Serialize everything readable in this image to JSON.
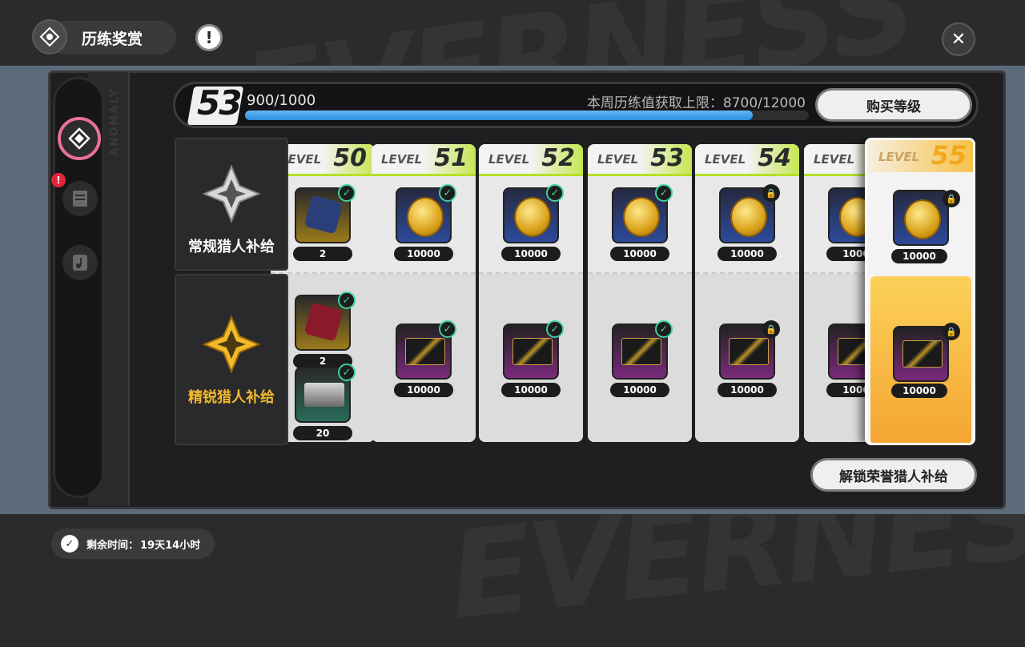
{
  "header": {
    "title": "历练奖赏",
    "info_icon": "exclamation-icon",
    "close_icon": "close-icon"
  },
  "background_text": [
    "EVERNESS",
    "EVERNESS"
  ],
  "sidebar": {
    "items": [
      {
        "icon": "pass-emblem-icon",
        "active": true
      },
      {
        "icon": "task-list-icon",
        "alert": "!"
      },
      {
        "icon": "music-note-icon"
      }
    ]
  },
  "progress": {
    "level": "53",
    "xp_text": "900/1000",
    "xp_fraction": 0.9,
    "weekly_limit": "本周历练值获取上限：8700/12000",
    "buy_level_button": "购买等级"
  },
  "tiers": {
    "normal": {
      "label": "常规猎人补给",
      "icon": "silver-star-emblem-icon"
    },
    "elite": {
      "label": "精锐猎人补给",
      "icon": "gold-star-emblem-icon"
    }
  },
  "level_word": "LEVEL",
  "levels": [
    {
      "level": "50",
      "normal": {
        "item": "dice-blue",
        "qty": "2",
        "status": "claimed"
      },
      "elite": [
        {
          "item": "dice-red",
          "qty": "2",
          "status": "claimed"
        },
        {
          "item": "box",
          "qty": "20",
          "status": "claimed"
        }
      ]
    },
    {
      "level": "51",
      "normal": {
        "item": "coin",
        "qty": "10000",
        "status": "claimed"
      },
      "elite": [
        {
          "item": "card",
          "qty": "10000",
          "status": "claimed"
        }
      ]
    },
    {
      "level": "52",
      "normal": {
        "item": "coin",
        "qty": "10000",
        "status": "claimed"
      },
      "elite": [
        {
          "item": "card",
          "qty": "10000",
          "status": "claimed"
        }
      ]
    },
    {
      "level": "53",
      "normal": {
        "item": "coin",
        "qty": "10000",
        "status": "claimed"
      },
      "elite": [
        {
          "item": "card",
          "qty": "10000",
          "status": "claimed"
        }
      ]
    },
    {
      "level": "54",
      "normal": {
        "item": "coin",
        "qty": "10000",
        "status": "locked"
      },
      "elite": [
        {
          "item": "card",
          "qty": "10000",
          "status": "locked"
        }
      ]
    },
    {
      "level": "",
      "normal": {
        "item": "coin",
        "qty": "1000",
        "status": "none"
      },
      "elite": [
        {
          "item": "card",
          "qty": "1000",
          "status": "none"
        }
      ]
    }
  ],
  "featured": {
    "level": "55",
    "normal": {
      "item": "coin",
      "qty": "10000",
      "status": "locked"
    },
    "elite": {
      "item": "card",
      "qty": "10000",
      "status": "locked"
    }
  },
  "unlock_button": "解锁荣誉猎人补给",
  "timer": {
    "label": "剩余时间：",
    "value": "19天14小时"
  },
  "colors": {
    "accent_green": "#b6e02a",
    "accent_pink": "#e8719a",
    "progress_blue": "#2b8ee0",
    "featured_gold": "#f2a81a",
    "claimed_check": "#3fd0a0"
  }
}
